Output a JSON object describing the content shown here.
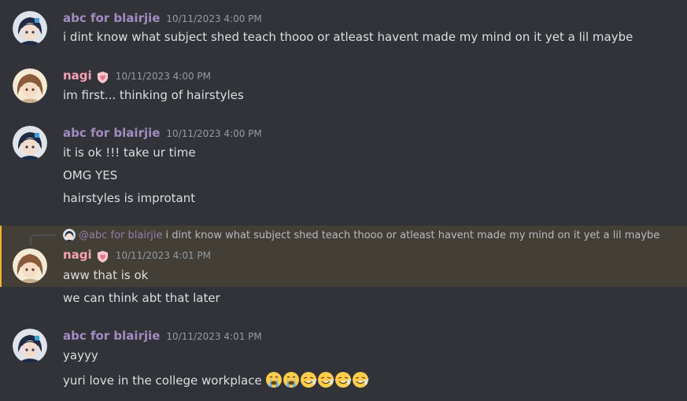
{
  "users": {
    "abc": {
      "name": "abc for blairjie",
      "color": "#a38bc2"
    },
    "nagi": {
      "name": "nagi",
      "color": "#f5a0b4"
    }
  },
  "messages": [
    {
      "author": "abc for blairjie",
      "timestamp": "10/11/2023 4:00 PM",
      "lines": [
        "i dint know what subject shed teach thooo or atleast havent made my mind on it yet a lil maybe"
      ]
    },
    {
      "author": "nagi",
      "timestamp": "10/11/2023 4:00 PM",
      "lines": [
        "im first... thinking of hairstyles"
      ]
    },
    {
      "author": "abc for blairjie",
      "timestamp": "10/11/2023 4:00 PM",
      "lines": [
        "it is ok !!! take ur time",
        "OMG YES",
        "hairstyles is improtant"
      ]
    },
    {
      "author": "nagi",
      "timestamp": "10/11/2023 4:01 PM",
      "reply": {
        "author": "@abc for blairjie",
        "text": "i dint know what subject shed teach thooo or atleast havent made my mind on it yet a lil maybe"
      },
      "lines": [
        "aww that is ok",
        "we can think abt that later"
      ]
    },
    {
      "author": "abc for blairjie",
      "timestamp": "10/11/2023 4:01 PM",
      "lines": [
        "yayyy",
        "yuri love in the college workplace"
      ]
    }
  ],
  "emoji_row": [
    "sob-emoji",
    "sob-emoji",
    "sweat-smile-emoji",
    "sweat-smile-emoji",
    "sweat-smile-emoji",
    "sweat-smile-emoji"
  ]
}
